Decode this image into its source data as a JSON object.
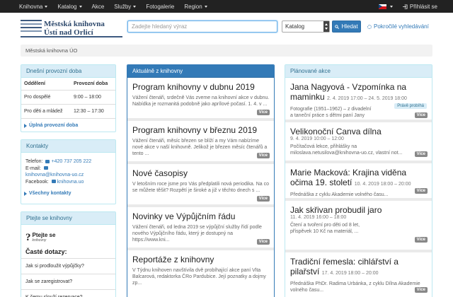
{
  "nav": {
    "items": [
      {
        "label": "Knihovna",
        "dropdown": true
      },
      {
        "label": "Katalog",
        "dropdown": true
      },
      {
        "label": "Akce",
        "dropdown": false
      },
      {
        "label": "Služby",
        "dropdown": true
      },
      {
        "label": "Fotogalerie",
        "dropdown": false
      },
      {
        "label": "Region",
        "dropdown": true
      }
    ],
    "login_label": "Přihlásit se"
  },
  "logo": {
    "line1": "Městská knihovna",
    "line2": "Ústí nad Orlicí"
  },
  "search": {
    "placeholder": "Zadejte hledaný výraz",
    "select_value": "Katalog",
    "button_label": "Hledat",
    "advanced_label": "Pokročilé vyhledávání"
  },
  "breadcrumb": "Městská knihovna ÚO",
  "hours": {
    "title": "Dnešní provozní doba",
    "col1": "Oddělení",
    "col2": "Provozní doba",
    "rows": [
      {
        "dept": "Pro dospělé",
        "time": "9:00 – 18:00"
      },
      {
        "dept": "Pro děti a mládež",
        "time": "12:30 – 17:30"
      }
    ],
    "link": "Úplná provozní doba"
  },
  "contacts": {
    "title": "Kontakty",
    "phone_label": "Telefon:",
    "phone": "+420 737 205 222",
    "email_label": "E-mail:",
    "email": "knihovna@knihovna-uo.cz",
    "facebook_label": "Facebook:",
    "facebook": "knihovna.uo",
    "link": "Všechny kontakty"
  },
  "ask": {
    "title": "Ptejte se knihovny",
    "logo_text": "Ptejte se",
    "logo_sub": "knihovny",
    "faq_title": "Časté dotazy:",
    "faq": [
      "Jak si prodloužit výpůjčky?",
      "Jak se zaregistrovat?",
      "K čemu slouží rezervace?"
    ]
  },
  "news": {
    "title": "Aktuálně z knihovny",
    "more_label": "Více",
    "items": [
      {
        "title": "Program knihovny v dubnu 2019",
        "text": "Vážení čtenáři, srdečně Vás zveme na knihovní akce v dubnu. Nabídka je rozmanitá podobně jako aprílové počasí. 1. 4. v ..."
      },
      {
        "title": "Program knihovny v březnu 2019",
        "text": "Vážení čtenáři, měsíc březen se blíží a my Vám nabízíme nové akce v naší knihovně. Jelikož je březen měsíc čtenářů a tento ..."
      },
      {
        "title": "Nové časopisy",
        "text": "V letošním roce jsme pro Vás předplatili nová periodika. Na co se můžete těšit? Rozpětí je široké a již v těchto dnech s ..."
      },
      {
        "title": "Novinky ve Výpůjčním řádu",
        "text": "Vážení čtenáři, od ledna 2019 se výpůjční služby řídí podle nového Výpůjčního řádu, který je dostupný na https://www.kni..."
      },
      {
        "title": "Reportáže z knihovny",
        "text": "V Týdnu knihoven navštívila dvě probíhající akce paní Vlta Balcarová, redaktorka ČRo Pardubice. Její poznatky a dojmy zp..."
      }
    ]
  },
  "events": {
    "title": "Plánované akce",
    "more_label": "Více",
    "ongoing_label": "Právě probíhá",
    "items": [
      {
        "title": "Jana Nagyová - Vzpomínka na maminku",
        "date": "2. 4. 2019 17:00 – 24. 5. 2019 18:00",
        "text": "Fotografie (1951–1962) – z divadelní a taneční práce s dětmi paní Jany Volfové..."
      },
      {
        "title": "Velikonoční Canva dílna",
        "date": "9. 4. 2019 10:00 – 12:00",
        "text": "Počítačová lekce, přihlášky na miloslava.netusilova@knihovna-uo.cz, vlastní not..."
      },
      {
        "title": "Marie Macková: Krajina viděna očima 19. století",
        "date": "10. 4. 2019 18:00 – 20:00",
        "text": "Přednáška z cyklu Akademie volného času..."
      },
      {
        "title": "Jak skřivan probudil jaro",
        "date": "11. 4. 2019 16:00 – 18:00",
        "text": "Čtení a tvoření pro děti od 8 let, příspěvek 10 Kč na materiál, ..."
      },
      {
        "title": "Tradiční řemesla: cihlářství a pilařství",
        "date": "17. 4. 2019 18:00 – 20:00",
        "text": "Přednáška PhDr. Radima Urbánka, z cyklu Dílna Akademie volného času..."
      }
    ]
  }
}
